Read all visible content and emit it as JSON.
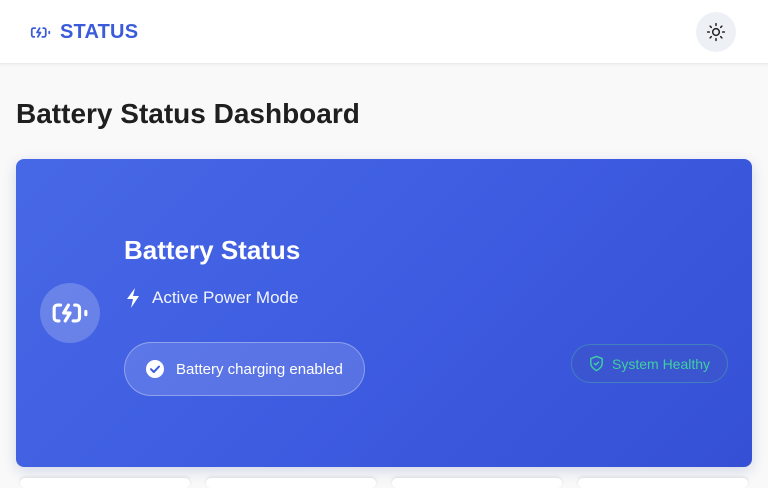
{
  "header": {
    "brand_label": "STATUS",
    "brand_icon": "battery-charging-icon",
    "theme_toggle_icon": "sun-icon"
  },
  "page": {
    "title": "Battery Status Dashboard"
  },
  "hero": {
    "icon": "battery-charging-icon",
    "title": "Battery Status",
    "mode_icon": "lightning-bolt-icon",
    "mode_label": "Active Power Mode",
    "charging_icon": "check-circle-icon",
    "charging_label": "Battery charging enabled",
    "health_icon": "shield-check-icon",
    "health_label": "System Healthy"
  },
  "colors": {
    "brand": "#3b5bdb",
    "hero_start": "#4768e6",
    "hero_end": "#3550d4",
    "health_green": "#3fd0a0"
  }
}
